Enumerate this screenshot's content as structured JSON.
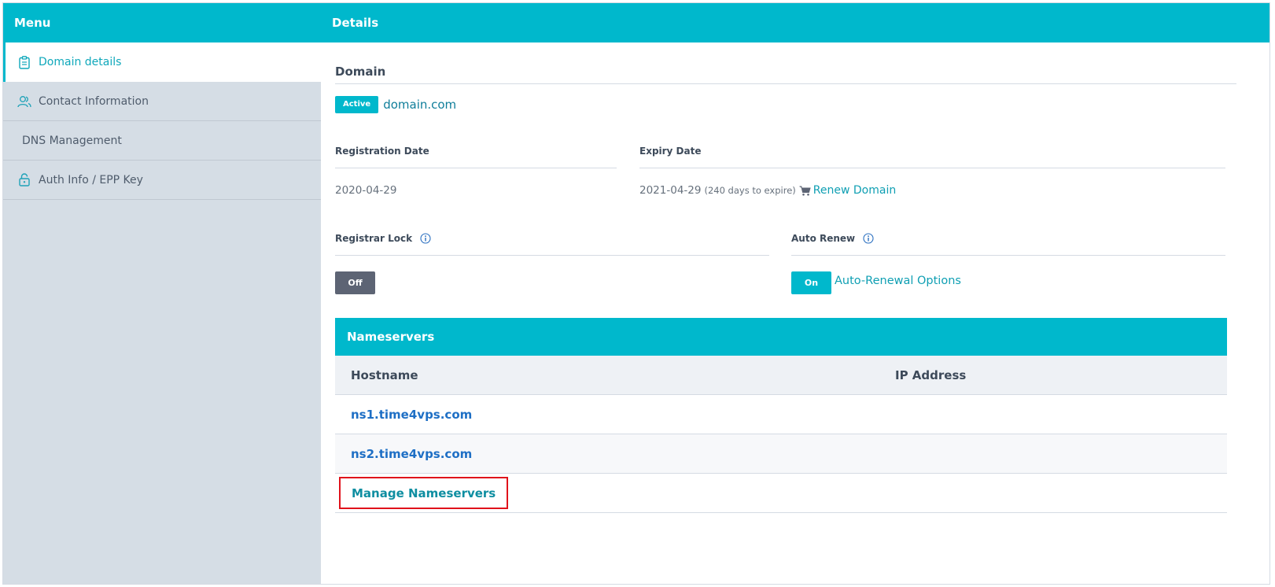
{
  "sidebar": {
    "title": "Menu",
    "items": [
      {
        "label": "Domain details",
        "icon": "clipboard-icon"
      },
      {
        "label": "Contact Information",
        "icon": "users-icon"
      },
      {
        "label": "DNS Management",
        "icon": ""
      },
      {
        "label": "Auth Info / EPP Key",
        "icon": "unlock-icon"
      }
    ]
  },
  "main": {
    "title": "Details",
    "domain_section": {
      "title": "Domain",
      "status_badge": "Active",
      "domain_name": "domain.com"
    },
    "registration": {
      "label": "Registration Date",
      "value": "2020-04-29"
    },
    "expiry": {
      "label": "Expiry Date",
      "value": "2021-04-29",
      "days_note": "(240 days to expire)",
      "renew_label": "Renew Domain"
    },
    "registrar_lock": {
      "label": "Registrar Lock",
      "toggle": "Off"
    },
    "auto_renew": {
      "label": "Auto Renew",
      "toggle": "On",
      "options_link": "Auto-Renewal Options"
    },
    "nameservers": {
      "title": "Nameservers",
      "columns": [
        "Hostname",
        "IP Address"
      ],
      "rows": [
        "ns1.time4vps.com",
        "ns2.time4vps.com"
      ],
      "manage_label": "Manage Nameservers"
    }
  },
  "colors": {
    "accent": "#00b8cc",
    "sidebar_bg": "#d5dde5",
    "toggle_off": "#5d6474",
    "link_blue": "#1e6fc5",
    "highlight_red": "#e0121b"
  }
}
